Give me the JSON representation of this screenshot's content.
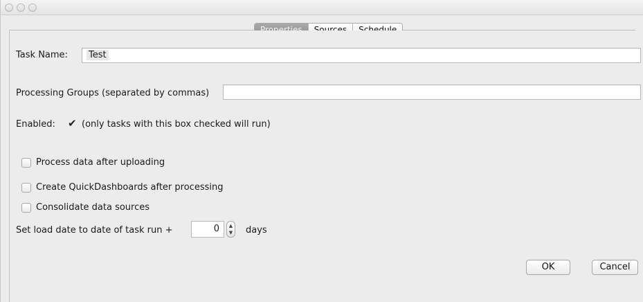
{
  "tabs": [
    "Properties",
    "Sources",
    "Schedule"
  ],
  "task_name": {
    "label": "Task Name:",
    "value": "Test"
  },
  "processing_groups": {
    "label": "Processing Groups (separated by commas)",
    "value": ""
  },
  "enabled": {
    "label": "Enabled:",
    "checked": true,
    "note": "(only tasks with this box checked will run)"
  },
  "options": [
    {
      "label": "Process data after uploading",
      "checked": false
    },
    {
      "label": "Create QuickDashboards after processing",
      "checked": false
    },
    {
      "label": "Consolidate data sources",
      "checked": false
    }
  ],
  "load_date": {
    "label": "Set load date to date of task run +",
    "value": "0",
    "unit": "days"
  },
  "buttons": {
    "ok": "OK",
    "cancel": "Cancel"
  }
}
